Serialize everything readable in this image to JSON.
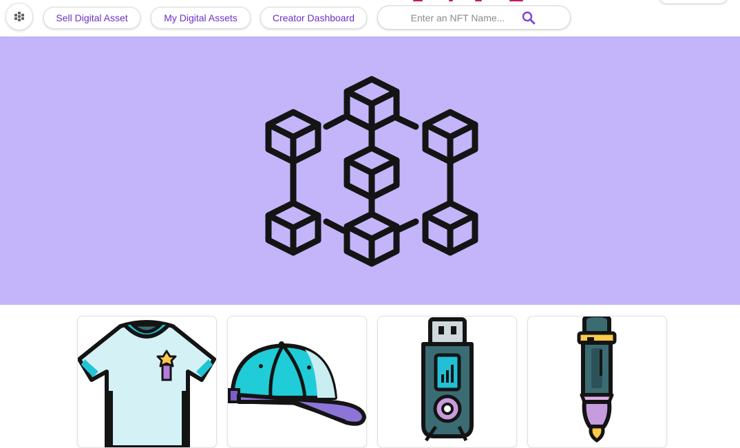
{
  "nav": {
    "logo_icon": "network-icon",
    "buttons": [
      {
        "label": "Sell Digital Asset"
      },
      {
        "label": "My Digital Assets"
      },
      {
        "label": "Creator Dashboard"
      }
    ]
  },
  "search": {
    "placeholder": "Enter an NFT Name...",
    "value": "",
    "icon": "search-icon"
  },
  "hero": {
    "icon": "blockchain-icon",
    "background": "#c4b5fa"
  },
  "cards": [
    {
      "icon": "tshirt-icon"
    },
    {
      "icon": "cap-icon"
    },
    {
      "icon": "usb-drive-icon"
    },
    {
      "icon": "pen-icon"
    }
  ],
  "colors": {
    "accent": "#6a2fc7",
    "hero_bg": "#c4b5fa"
  }
}
